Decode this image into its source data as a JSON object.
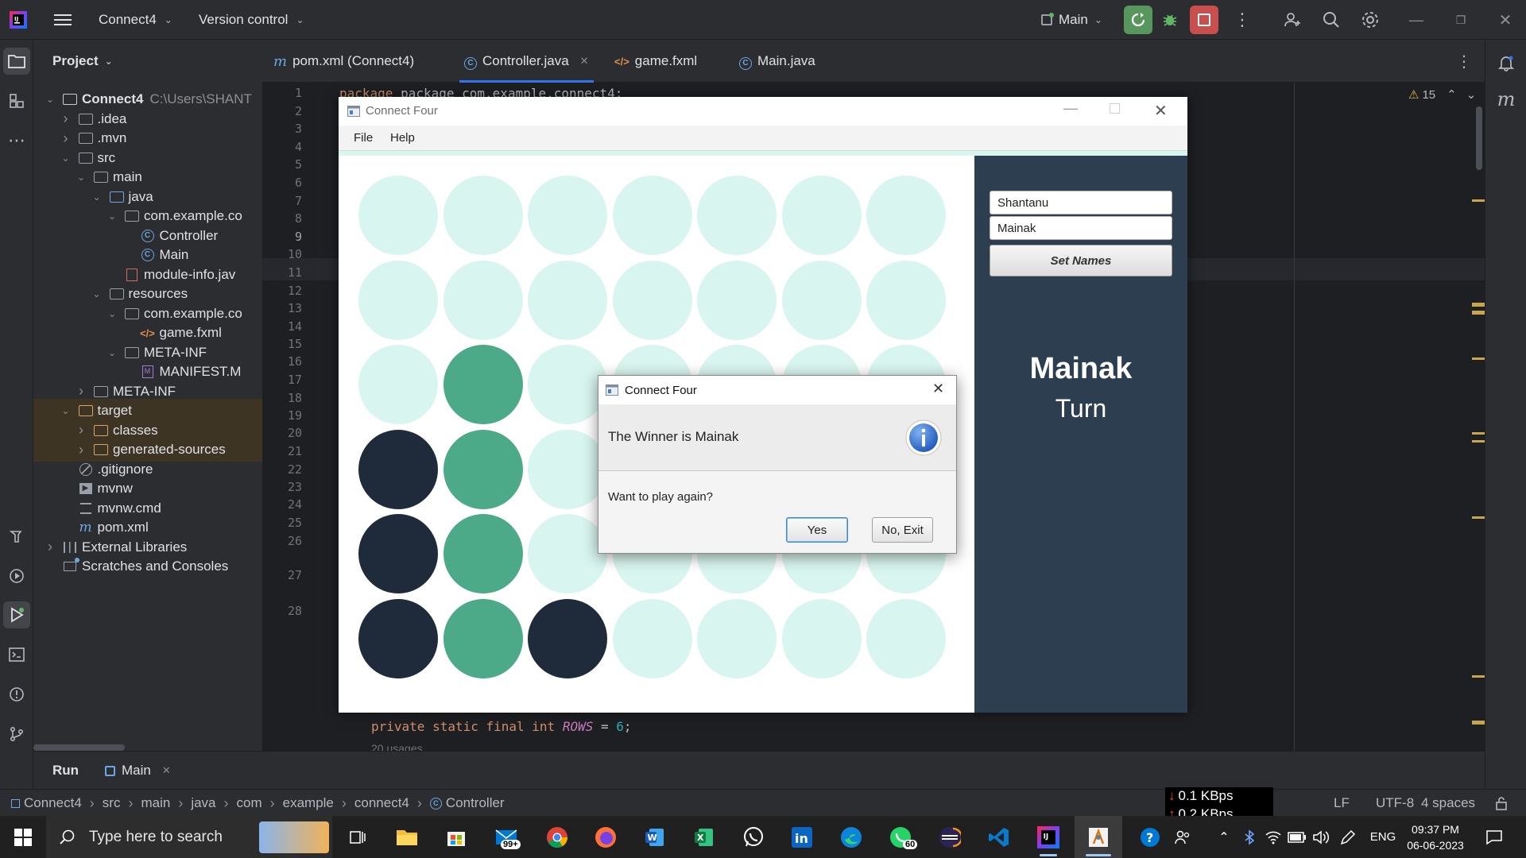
{
  "ide": {
    "project_name": "Connect4",
    "vcs_menu": "Version control",
    "run_config": "Main",
    "project_panel_title": "Project",
    "accent": "#3574f0"
  },
  "tree": [
    {
      "label": "Connect4",
      "path": "C:\\Users\\SHANT",
      "depth": 0,
      "open": "open",
      "icon": "module-folder-icon",
      "bold": true
    },
    {
      "label": ".idea",
      "depth": 1,
      "open": "closed",
      "icon": "folder-icon"
    },
    {
      "label": ".mvn",
      "depth": 1,
      "open": "closed",
      "icon": "folder-icon"
    },
    {
      "label": "src",
      "depth": 1,
      "open": "open",
      "icon": "folder-icon"
    },
    {
      "label": "main",
      "depth": 2,
      "open": "open",
      "icon": "folder-icon"
    },
    {
      "label": "java",
      "depth": 3,
      "open": "open",
      "icon": "source-folder-icon"
    },
    {
      "label": "com.example.co",
      "depth": 4,
      "open": "open",
      "icon": "package-icon"
    },
    {
      "label": "Controller",
      "depth": 5,
      "open": "none",
      "icon": "class-icon"
    },
    {
      "label": "Main",
      "depth": 5,
      "open": "none",
      "icon": "class-icon"
    },
    {
      "label": "module-info.jav",
      "depth": 4,
      "open": "none",
      "icon": "module-info-icon"
    },
    {
      "label": "resources",
      "depth": 3,
      "open": "open",
      "icon": "resources-folder-icon"
    },
    {
      "label": "com.example.co",
      "depth": 4,
      "open": "open",
      "icon": "folder-icon"
    },
    {
      "label": "game.fxml",
      "depth": 5,
      "open": "none",
      "icon": "fxml-icon"
    },
    {
      "label": "META-INF",
      "depth": 4,
      "open": "open",
      "icon": "folder-icon"
    },
    {
      "label": "MANIFEST.M",
      "depth": 5,
      "open": "none",
      "icon": "manifest-icon"
    },
    {
      "label": "META-INF",
      "depth": 2,
      "open": "closed",
      "icon": "folder-icon"
    },
    {
      "label": "target",
      "depth": 1,
      "open": "open",
      "icon": "excluded-folder-icon",
      "excluded": true
    },
    {
      "label": "classes",
      "depth": 2,
      "open": "closed",
      "icon": "excluded-folder-icon",
      "excluded": true
    },
    {
      "label": "generated-sources",
      "depth": 2,
      "open": "closed",
      "icon": "excluded-folder-icon",
      "excluded": true
    },
    {
      "label": ".gitignore",
      "depth": 1,
      "open": "none",
      "icon": "gitignore-icon"
    },
    {
      "label": "mvnw",
      "depth": 1,
      "open": "none",
      "icon": "script-icon"
    },
    {
      "label": "mvnw.cmd",
      "depth": 1,
      "open": "none",
      "icon": "text-file-icon"
    },
    {
      "label": "pom.xml",
      "depth": 1,
      "open": "none",
      "icon": "maven-icon"
    },
    {
      "label": "External Libraries",
      "depth": 0,
      "open": "closed",
      "icon": "library-icon"
    },
    {
      "label": "Scratches and Consoles",
      "depth": 0,
      "open": "none",
      "icon": "scratches-icon"
    }
  ],
  "tabs": [
    {
      "label": "pom.xml (Connect4)",
      "icon": "maven-icon",
      "active": false
    },
    {
      "label": "Controller.java",
      "icon": "class-icon",
      "active": true
    },
    {
      "label": "game.fxml",
      "icon": "fxml-icon",
      "active": false
    },
    {
      "label": "Main.java",
      "icon": "class-icon",
      "active": false
    }
  ],
  "editor": {
    "line_numbers": [
      "1",
      "2",
      "3",
      "4",
      "5",
      "6",
      "7",
      "8",
      "9",
      "10",
      "11",
      "12",
      "13",
      "14",
      "15",
      "16",
      "17",
      "18",
      "19",
      "20",
      "21",
      "22",
      "23",
      "24",
      "25",
      "26",
      "27",
      "28"
    ],
    "line1_code": "package com.example.connect4;",
    "line28_code": {
      "kw1": "private static final int ",
      "name": "ROWS",
      "rest": " = ",
      "num": "6",
      "end": ";"
    },
    "usages_hint": "20 usages",
    "warnings_count": "15"
  },
  "game": {
    "window_title": "Connect Four",
    "menu": [
      "File",
      "Help"
    ],
    "player1_name": "Shantanu",
    "player2_name": "Mainak",
    "set_names_label": "Set Names",
    "turn_player": "Mainak",
    "turn_label": "Turn",
    "colors": {
      "empty": "#d9f5ef",
      "player1": "#4caa88",
      "player2": "#1f2b3a",
      "panel": "#2c3e50"
    },
    "board": [
      [
        0,
        0,
        0,
        0,
        0,
        0,
        0
      ],
      [
        0,
        0,
        0,
        0,
        0,
        0,
        0
      ],
      [
        0,
        1,
        0,
        0,
        0,
        0,
        0
      ],
      [
        2,
        1,
        0,
        0,
        0,
        0,
        0
      ],
      [
        2,
        1,
        0,
        0,
        0,
        0,
        0
      ],
      [
        2,
        1,
        2,
        0,
        0,
        0,
        0
      ]
    ]
  },
  "dialog": {
    "title": "Connect Four",
    "header": "The Winner is Mainak",
    "content": "Want to play again?",
    "yes_label": "Yes",
    "no_label": "No, Exit"
  },
  "run_panel": {
    "tab_run": "Run",
    "tab_main": "Main"
  },
  "breadcrumbs": [
    "Connect4",
    "src",
    "main",
    "java",
    "com",
    "example",
    "connect4",
    "Controller"
  ],
  "status": {
    "line_sep": "LF",
    "encoding": "UTF-8",
    "indent": "4 spaces"
  },
  "network": {
    "down": "0.1 KBps",
    "up": "0.2 KBps"
  },
  "taskbar": {
    "search_placeholder": "Type here to search",
    "mail_badge": "99+",
    "whatsapp_badge": "60",
    "language": "ENG",
    "time": "09:37 PM",
    "date": "06-06-2023"
  }
}
